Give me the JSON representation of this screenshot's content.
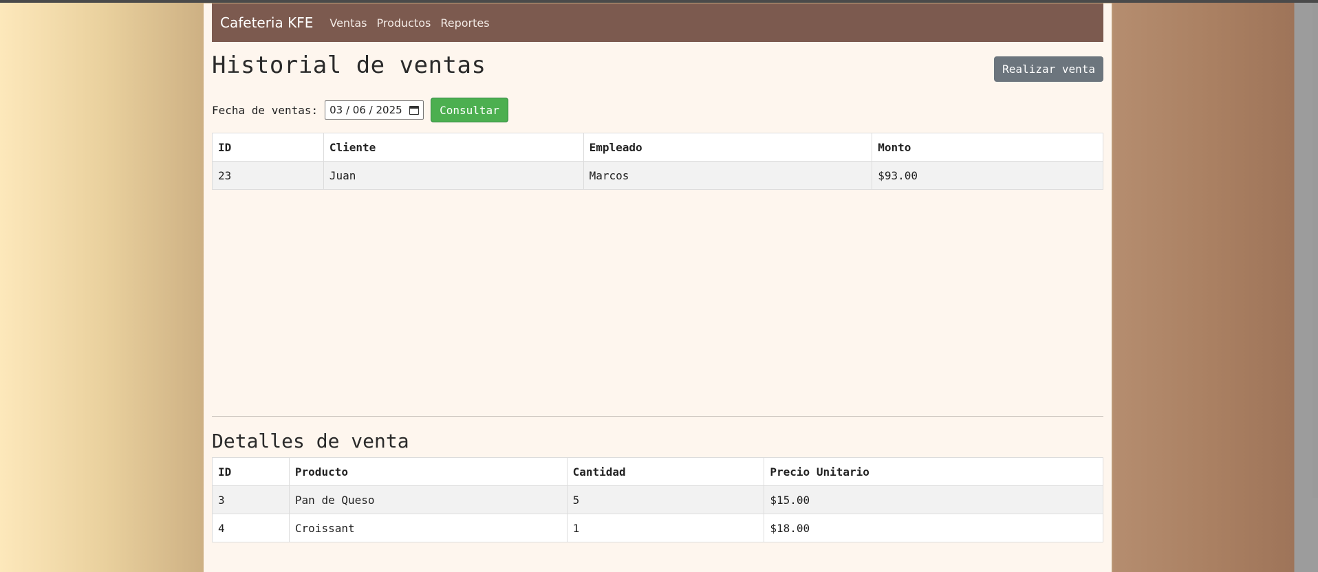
{
  "navbar": {
    "brand": "Cafeteria KFE",
    "links": [
      "Ventas",
      "Productos",
      "Reportes"
    ]
  },
  "page": {
    "title": "Historial de ventas",
    "new_sale_label": "Realizar venta"
  },
  "filter": {
    "label": "Fecha de ventas:",
    "date_value": "03 / 06 / 2025",
    "submit_label": "Consultar"
  },
  "sales_table": {
    "headers": [
      "ID",
      "Cliente",
      "Empleado",
      "Monto"
    ],
    "rows": [
      [
        "23",
        "Juan",
        "Marcos",
        "$93.00"
      ]
    ]
  },
  "details": {
    "title": "Detalles de venta",
    "headers": [
      "ID",
      "Producto",
      "Cantidad",
      "Precio Unitario"
    ],
    "rows": [
      [
        "3",
        "Pan de Queso",
        "5",
        "$15.00"
      ],
      [
        "4",
        "Croissant",
        "1",
        "$18.00"
      ]
    ]
  },
  "colors": {
    "navbar": "#7c5a4f",
    "primary_button": "#6c757d",
    "success_button": "#4caf50",
    "page_background": "#fef6ee"
  }
}
